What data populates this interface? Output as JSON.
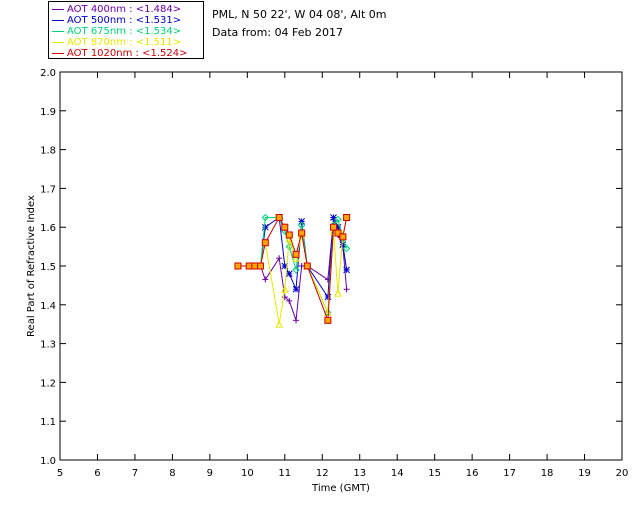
{
  "header": {
    "site_line": "PML, N 50 22', W 04 08', Alt 0m",
    "date_line": "Data from: 04 Feb 2017"
  },
  "chart_data": {
    "type": "line",
    "title": "",
    "xlabel": "Time (GMT)",
    "ylabel": "Real Part of Refractive Index",
    "xlim": [
      5,
      20
    ],
    "ylim": [
      1.0,
      2.0
    ],
    "x_ticks": [
      5,
      6,
      7,
      8,
      9,
      10,
      11,
      12,
      13,
      14,
      15,
      16,
      17,
      18,
      19,
      20
    ],
    "y_ticks": [
      1.0,
      1.1,
      1.2,
      1.3,
      1.4,
      1.5,
      1.6,
      1.7,
      1.8,
      1.9,
      2.0
    ],
    "x_tick_labels": [
      "5",
      "6",
      "7",
      "8",
      "9",
      "10",
      "11",
      "12",
      "13",
      "14",
      "15",
      "16",
      "17",
      "18",
      "19",
      "20"
    ],
    "y_tick_labels": [
      "1.0",
      "1.1",
      "1.2",
      "1.3",
      "1.4",
      "1.5",
      "1.6",
      "1.7",
      "1.8",
      "1.9",
      "2.0"
    ],
    "grid": false,
    "legend_position": "top-left, outside plot",
    "series": [
      {
        "name": "AOT  400nm : <1.484>",
        "color": "#6a00a8",
        "marker": "plus",
        "x": [
          9.75,
          10.05,
          10.2,
          10.35,
          10.48,
          10.85,
          11.0,
          11.12,
          11.3,
          11.45,
          11.6,
          12.15,
          12.3,
          12.42,
          12.55,
          12.65
        ],
        "y": [
          1.5,
          1.5,
          1.5,
          1.5,
          1.465,
          1.52,
          1.42,
          1.41,
          1.36,
          1.5,
          1.5,
          1.465,
          1.62,
          1.58,
          1.55,
          1.44
        ]
      },
      {
        "name": "AOT  500nm : <1.531>",
        "color": "#0000cc",
        "marker": "asterisk",
        "x": [
          9.75,
          10.05,
          10.2,
          10.35,
          10.48,
          10.85,
          11.0,
          11.12,
          11.3,
          11.45,
          11.6,
          12.15,
          12.3,
          12.42,
          12.55,
          12.65
        ],
        "y": [
          1.5,
          1.5,
          1.5,
          1.5,
          1.6,
          1.625,
          1.5,
          1.48,
          1.44,
          1.615,
          1.5,
          1.42,
          1.625,
          1.6,
          1.555,
          1.49
        ]
      },
      {
        "name": "AOT  675nm : <1.534>",
        "color": "#00d27a",
        "marker": "diamond",
        "x": [
          9.75,
          10.05,
          10.2,
          10.35,
          10.48,
          10.85,
          11.0,
          11.12,
          11.3,
          11.45,
          11.6,
          12.15,
          12.3,
          12.42,
          12.55,
          12.65
        ],
        "y": [
          1.5,
          1.5,
          1.5,
          1.5,
          1.625,
          1.625,
          1.59,
          1.55,
          1.49,
          1.605,
          1.5,
          1.38,
          1.605,
          1.62,
          1.57,
          1.545
        ]
      },
      {
        "name": "AOT  870nm : <1.511>",
        "color": "#e8e800",
        "marker": "triangle",
        "x": [
          9.75,
          10.05,
          10.2,
          10.35,
          10.48,
          10.85,
          11.0,
          11.12,
          11.3,
          11.45,
          11.6,
          12.15,
          12.3,
          12.42,
          12.55,
          12.65
        ],
        "y": [
          1.5,
          1.5,
          1.5,
          1.5,
          1.56,
          1.35,
          1.44,
          1.57,
          1.52,
          1.58,
          1.5,
          1.38,
          1.59,
          1.43,
          1.58,
          1.625
        ]
      },
      {
        "name": "AOT 1020nm : <1.524>",
        "color": "#cc0000",
        "marker": "square",
        "x": [
          9.75,
          10.05,
          10.2,
          10.35,
          10.48,
          10.85,
          11.0,
          11.12,
          11.3,
          11.45,
          11.6,
          12.15,
          12.3,
          12.42,
          12.55,
          12.65
        ],
        "y": [
          1.5,
          1.5,
          1.5,
          1.5,
          1.56,
          1.625,
          1.6,
          1.58,
          1.53,
          1.585,
          1.5,
          1.36,
          1.6,
          1.585,
          1.575,
          1.625
        ]
      }
    ],
    "marker_fill": "#ffa500"
  }
}
